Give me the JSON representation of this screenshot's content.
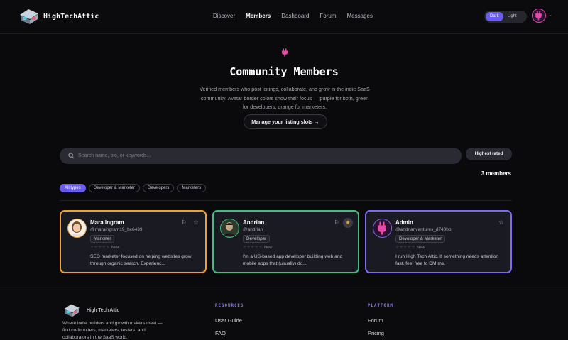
{
  "header": {
    "brand": "HighTechAttic",
    "nav": [
      "Discover",
      "Members",
      "Dashboard",
      "Forum",
      "Messages"
    ],
    "active_nav": "Members",
    "theme": {
      "dark": "Dark",
      "light": "Light",
      "selected": "Dark"
    }
  },
  "hero": {
    "title": "Community Members",
    "description": "Verified members who post listings, collaborate, and grow in the indie SaaS community. Avatar border colors show their focus — purple for both, green for developers, orange for marketers.",
    "manage_button": "Manage your listing slots →"
  },
  "search": {
    "placeholder": "Search name, bio, or keywords...",
    "sort_label": "Highest rated",
    "count_text": "3 members"
  },
  "filters": [
    "All types",
    "Developer & Marketer",
    "Developers",
    "Marketers"
  ],
  "active_filter": "All types",
  "members": [
    {
      "name": "Mara Ingram",
      "handle": "@maraingram19_bc6439",
      "role": "Marketer",
      "rating_text": "New",
      "bio": "SEO marketer focused on helping websites grow through organic search. Experienc...",
      "border_color": "#f0a030",
      "favorited": false
    },
    {
      "name": "Andrian",
      "handle": "@andrian",
      "role": "Developer",
      "rating_text": "New",
      "bio": "I'm a US-based app developer building web and mobile apps that (usually) do...",
      "border_color": "#3fbf7f",
      "favorited": true
    },
    {
      "name": "Admin",
      "handle": "@andrianventures_d740bb",
      "role": "Developer & Marketer",
      "rating_text": "New",
      "bio": "I run High Tech Attic. If something needs attention fast, feel free to DM me.",
      "border_color": "#7b6cf0",
      "favorited": false
    }
  ],
  "footer": {
    "brand": "High Tech Attic",
    "description": "Where indie builders and growth makers meet — find co-founders, marketers, testers, and collaborators in the SaaS world.",
    "resources_heading": "RESOURCES",
    "resources_links": [
      "User Guide",
      "FAQ"
    ],
    "platform_heading": "PLATFORM",
    "platform_links": [
      "Forum",
      "Pricing"
    ]
  },
  "colors": {
    "accent": "#6b5cf0",
    "background": "#0a0a0c",
    "card": "#1a1a22"
  }
}
